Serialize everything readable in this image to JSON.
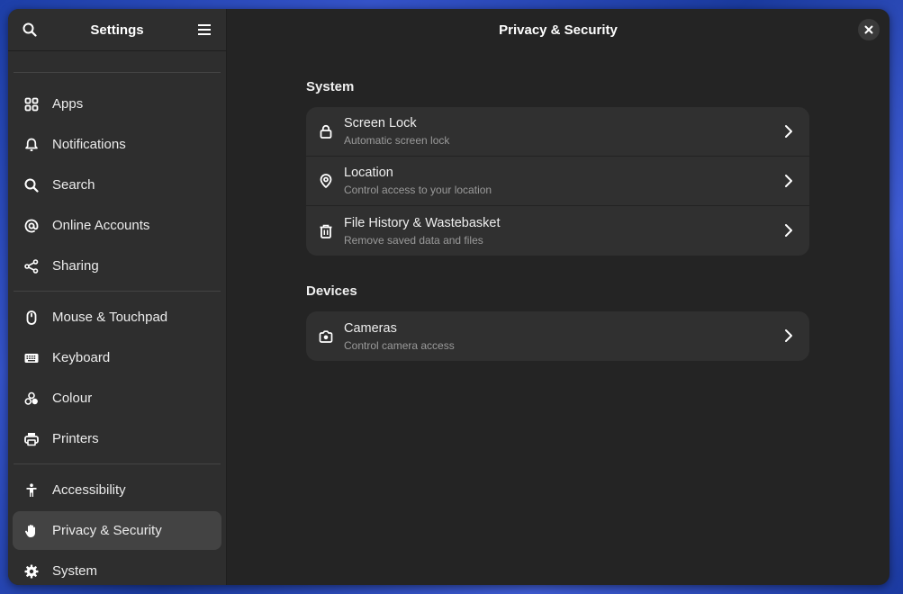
{
  "sidebar": {
    "title": "Settings",
    "search_icon": "search-icon",
    "menu_icon": "hamburger-menu-icon",
    "groups": [
      [
        {
          "label": "Apps",
          "icon": "apps-grid-icon"
        },
        {
          "label": "Notifications",
          "icon": "bell-icon"
        },
        {
          "label": "Search",
          "icon": "search-icon"
        },
        {
          "label": "Online Accounts",
          "icon": "at-sign-icon"
        },
        {
          "label": "Sharing",
          "icon": "share-icon"
        }
      ],
      [
        {
          "label": "Mouse & Touchpad",
          "icon": "mouse-icon"
        },
        {
          "label": "Keyboard",
          "icon": "keyboard-icon"
        },
        {
          "label": "Colour",
          "icon": "colour-icon"
        },
        {
          "label": "Printers",
          "icon": "printer-icon"
        }
      ],
      [
        {
          "label": "Accessibility",
          "icon": "accessibility-icon"
        },
        {
          "label": "Privacy & Security",
          "icon": "hand-icon",
          "active": true
        },
        {
          "label": "System",
          "icon": "gear-icon"
        }
      ]
    ]
  },
  "main": {
    "title": "Privacy & Security",
    "close_icon": "close-icon",
    "sections": [
      {
        "title": "System",
        "rows": [
          {
            "title": "Screen Lock",
            "subtitle": "Automatic screen lock",
            "icon": "lock-icon"
          },
          {
            "title": "Location",
            "subtitle": "Control access to your location",
            "icon": "location-pin-icon"
          },
          {
            "title": "File History & Wastebasket",
            "subtitle": "Remove saved data and files",
            "icon": "trash-icon"
          }
        ]
      },
      {
        "title": "Devices",
        "rows": [
          {
            "title": "Cameras",
            "subtitle": "Control camera access",
            "icon": "camera-icon"
          }
        ]
      }
    ]
  },
  "colors": {
    "sidebar_bg": "#2e2e2e",
    "main_bg": "#242424",
    "row_bg": "#303030",
    "active_item_bg": "#434343"
  }
}
